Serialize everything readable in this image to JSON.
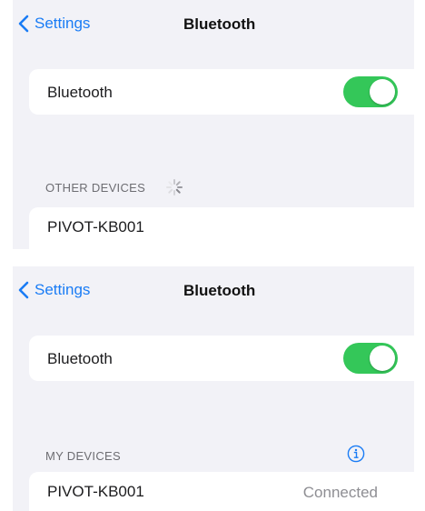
{
  "screens": [
    {
      "nav": {
        "back_label": "Settings",
        "title": "Bluetooth"
      },
      "bluetooth_row": {
        "label": "Bluetooth",
        "toggle_on": true
      },
      "section_header": "OTHER DEVICES",
      "section_busy": true,
      "devices": [
        {
          "name": "PIVOT-KB001",
          "status": ""
        }
      ]
    },
    {
      "nav": {
        "back_label": "Settings",
        "title": "Bluetooth"
      },
      "bluetooth_row": {
        "label": "Bluetooth",
        "toggle_on": true
      },
      "section_header": "MY DEVICES",
      "devices": [
        {
          "name": "PIVOT-KB001",
          "status": "Connected"
        }
      ]
    }
  ],
  "colors": {
    "accent_blue": "#1a7cf5",
    "toggle_green": "#34c759",
    "background": "#f2f2f7",
    "secondary_text": "#8e8e93"
  },
  "icons": [
    "chevron-left-icon",
    "loading-spinner-icon",
    "info-icon"
  ]
}
